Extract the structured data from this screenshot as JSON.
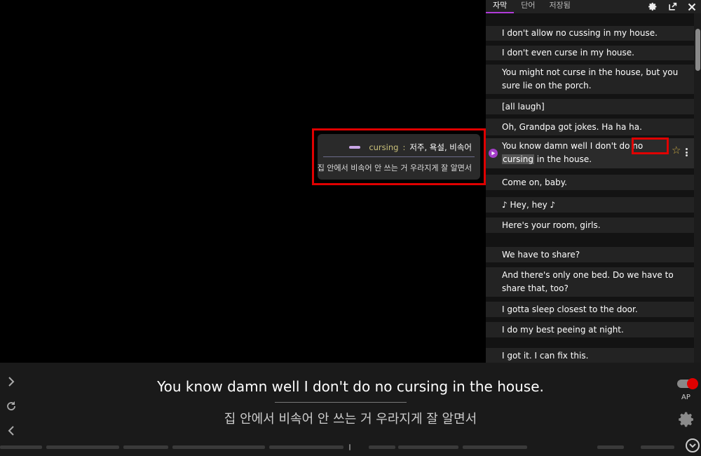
{
  "panel": {
    "tabs": [
      {
        "label": "자막",
        "active": true
      },
      {
        "label": "단어",
        "active": false
      },
      {
        "label": "저장됨",
        "active": false
      }
    ],
    "icons": [
      "gear-icon",
      "export-icon",
      "close-icon"
    ]
  },
  "subtitles": [
    {
      "text": "I don't allow no cussing in my house."
    },
    {
      "text": "I don't even curse in my house."
    },
    {
      "text": "You might not curse in the house, but you sure lie on the porch."
    },
    {
      "text": "[all laugh]"
    },
    {
      "text": "Oh, Grandpa got jokes. Ha ha ha."
    },
    {
      "pre": "You know damn well I don't do no ",
      "highlight": "cursing",
      "post": " in the house.",
      "active": true
    },
    {
      "text": "Come on, baby."
    },
    {
      "text": "♪  Hey, hey  ♪"
    },
    {
      "text": "Here's your room, girls."
    },
    {
      "text": "We have to share?"
    },
    {
      "text": "And there's only one bed. Do we have to share that, too?"
    },
    {
      "text": "I gotta sleep closest to the door."
    },
    {
      "text": "I do my best peeing at night."
    },
    {
      "text": "I got it. I can fix this."
    }
  ],
  "popup": {
    "word": "cursing",
    "separator": " : ",
    "meaning": "저주, 욕설, 비속어",
    "translation": "집 안에서 비속어 안 쓰는 거 우라지게 잘 알면서"
  },
  "player": {
    "subtitle": "You know damn well I don't do no cursing in the house.",
    "translation": "집 안에서 비속어 안 쓰는 거 우라지게 잘 알면서",
    "ap_label": "AP",
    "autopause_on": true
  },
  "colors": {
    "accent": "#b13bd9",
    "highlight_box": "#e00000",
    "word_color": "#c9c07a"
  }
}
